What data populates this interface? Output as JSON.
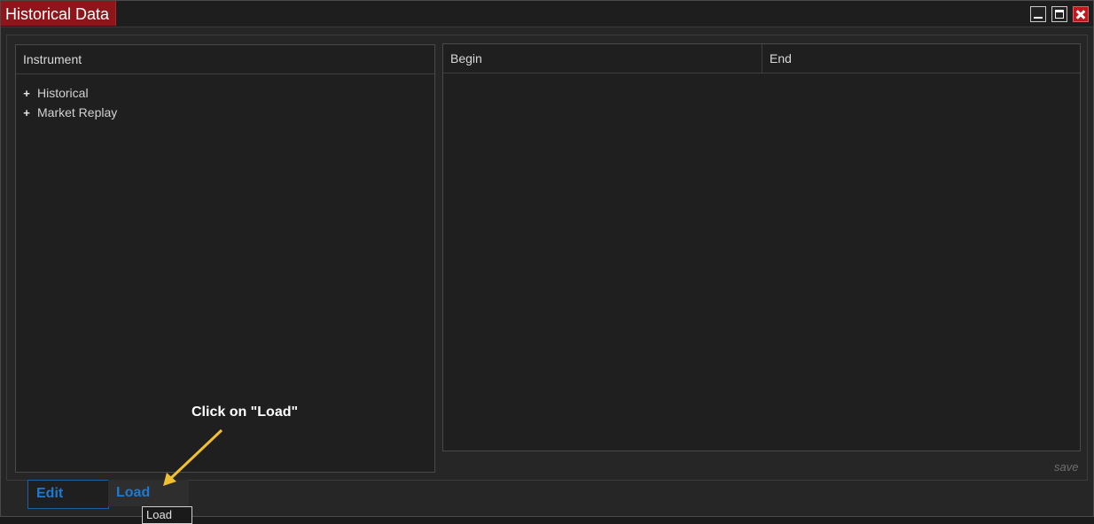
{
  "window": {
    "title": "Historical Data",
    "controls": [
      "minimize-icon",
      "maximize-icon",
      "close-icon"
    ]
  },
  "instrument_panel": {
    "header": "Instrument",
    "items": [
      {
        "label": "Historical",
        "icon": "expand-plus-icon"
      },
      {
        "label": "Market Replay",
        "icon": "expand-plus-icon"
      }
    ]
  },
  "data_panel": {
    "columns": [
      "Begin",
      "End"
    ],
    "save_label": "save"
  },
  "tabs": [
    {
      "label": "Edit"
    },
    {
      "label": "Load"
    }
  ],
  "tooltip": "Load",
  "annotation": {
    "text": "Click on \"Load\"",
    "color": "#f0c030"
  },
  "colors": {
    "title_bg": "#8e161a",
    "tab_text": "#1e7ad0",
    "background": "#1f1f1f"
  }
}
